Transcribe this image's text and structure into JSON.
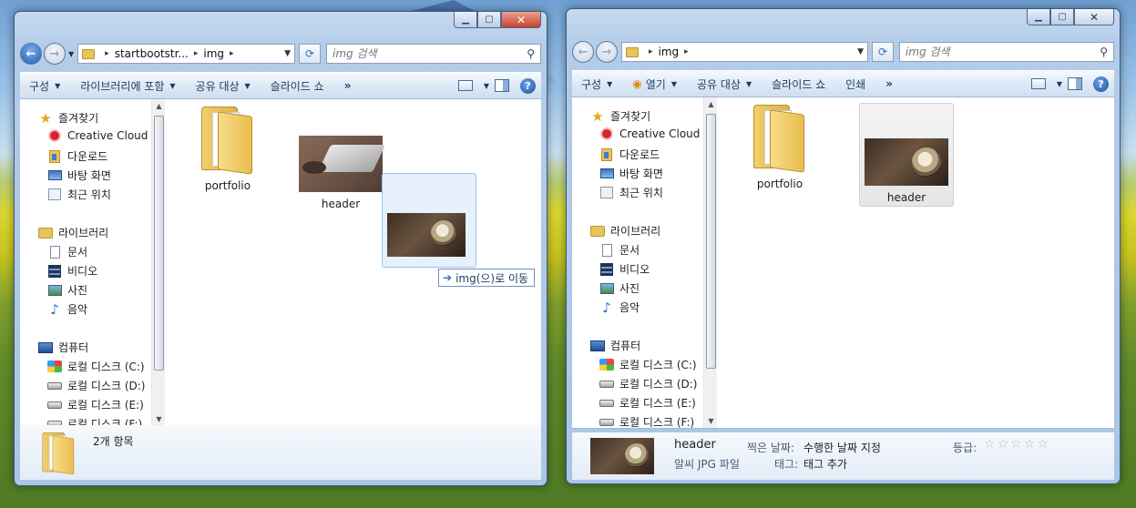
{
  "left_window": {
    "address": {
      "crumbs": [
        "startbootstr...",
        "img"
      ]
    },
    "search_placeholder": "img 검색",
    "toolbar": {
      "organize": "구성",
      "include_library": "라이브러리에 포함",
      "share": "공유 대상",
      "slideshow": "슬라이드 쇼",
      "more": "»"
    },
    "sidebar": {
      "favorites": "즐겨찾기",
      "creative_cloud": "Creative Cloud F",
      "downloads": "다운로드",
      "desktop": "바탕 화면",
      "recent": "최근 위치",
      "libraries": "라이브러리",
      "documents": "문서",
      "videos": "비디오",
      "pictures": "사진",
      "music": "음악",
      "computer": "컴퓨터",
      "drive_c": "로컬 디스크 (C:)",
      "drive_d": "로컬 디스크 (D:)",
      "drive_e": "로컬 디스크 (E:)",
      "drive_f": "로컬 디스크 (F:)"
    },
    "files": [
      {
        "name": "portfolio",
        "type": "folder"
      },
      {
        "name": "header",
        "type": "image"
      }
    ],
    "drag_tooltip": "img(으)로 이동",
    "status": "2개 항목"
  },
  "right_window": {
    "address": {
      "crumbs": [
        "img"
      ]
    },
    "search_placeholder": "img 검색",
    "toolbar": {
      "organize": "구성",
      "open": "열기",
      "share": "공유 대상",
      "slideshow": "슬라이드 쇼",
      "print": "인쇄",
      "more": "»"
    },
    "sidebar": {
      "favorites": "즐겨찾기",
      "creative_cloud": "Creative Cloud F",
      "downloads": "다운로드",
      "desktop": "바탕 화면",
      "recent": "최근 위치",
      "libraries": "라이브러리",
      "documents": "문서",
      "videos": "비디오",
      "pictures": "사진",
      "music": "음악",
      "computer": "컴퓨터",
      "drive_c": "로컬 디스크 (C:)",
      "drive_d": "로컬 디스크 (D:)",
      "drive_e": "로컬 디스크 (E:)",
      "drive_f": "로컬 디스크 (F:)"
    },
    "files": [
      {
        "name": "portfolio",
        "type": "folder"
      },
      {
        "name": "header",
        "type": "image",
        "selected": true
      }
    ],
    "details": {
      "name": "header",
      "type": "알씨 JPG 파일",
      "date_label": "찍은 날짜:",
      "date_value": "수행한 날짜 지정",
      "tags_label": "태그:",
      "tags_value": "태그 추가",
      "rating_label": "등급:",
      "rating": 0,
      "rating_max": 5
    }
  },
  "icons": [
    "star-icon",
    "folder-icon",
    "search-icon",
    "refresh-icon",
    "help-icon",
    "view-icon",
    "preview-pane-icon",
    "back-icon",
    "forward-icon",
    "move-arrow-icon"
  ]
}
